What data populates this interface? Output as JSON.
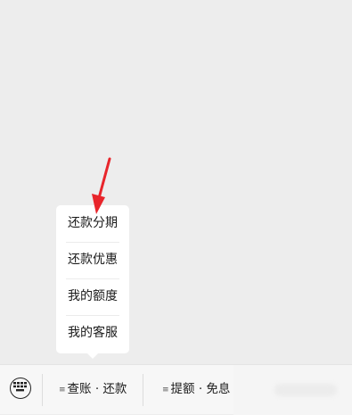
{
  "popup_menu": {
    "items": [
      {
        "label": "还款分期"
      },
      {
        "label": "还款优惠"
      },
      {
        "label": "我的额度"
      },
      {
        "label": "我的客服"
      }
    ]
  },
  "bottom_menu": {
    "keyboard_icon": "keyboard-icon",
    "tabs": [
      {
        "label": "查账 · 还款",
        "icon": "menu-lines-icon"
      },
      {
        "label": "提额 · 免息",
        "icon": "menu-lines-icon"
      }
    ]
  },
  "colors": {
    "background": "#ededed",
    "popup": "#ffffff",
    "annotation_arrow": "#e8252b",
    "bottom_bar": "#f7f7f7"
  }
}
